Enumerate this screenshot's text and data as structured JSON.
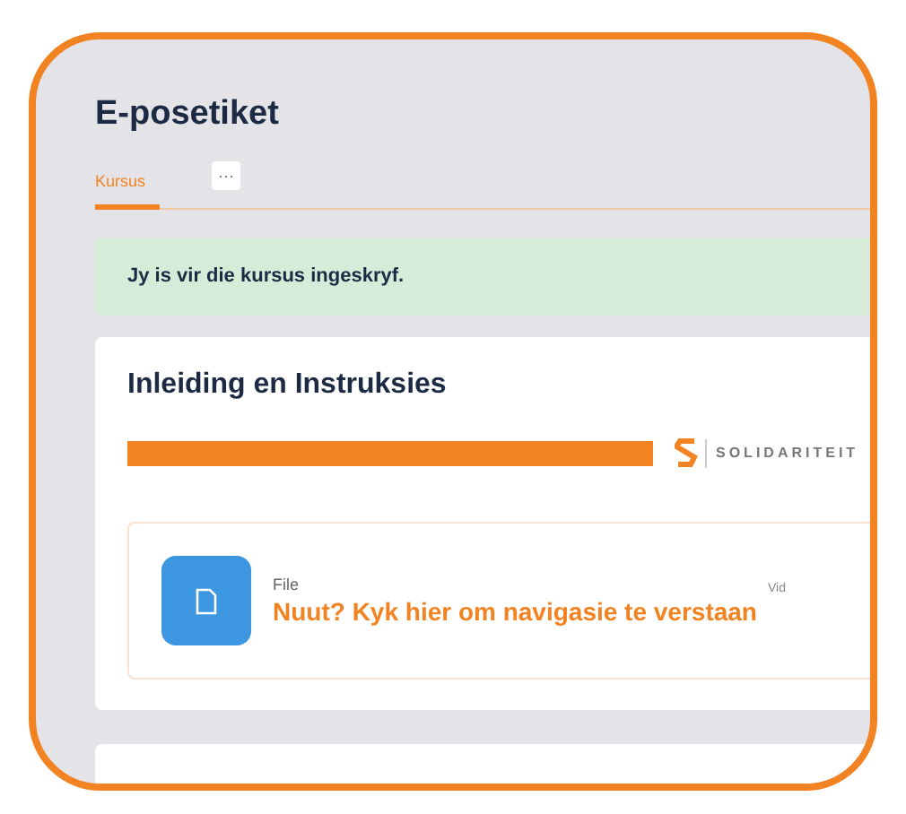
{
  "page": {
    "title": "E-posetiket"
  },
  "tabs": [
    {
      "label": "Kursus",
      "selected": true
    }
  ],
  "more_button": {
    "label": "···"
  },
  "alert": {
    "text": "Jy is vir die kursus ingeskryf."
  },
  "section": {
    "title": "Inleiding en Instruksies",
    "banner": {
      "brand": "SOLIDARITEIT"
    },
    "items": [
      {
        "kind": "file",
        "type_label": "File",
        "title": "Nuut? Kyk hier om navigasie te verstaan",
        "side_label": "Vid"
      }
    ]
  }
}
